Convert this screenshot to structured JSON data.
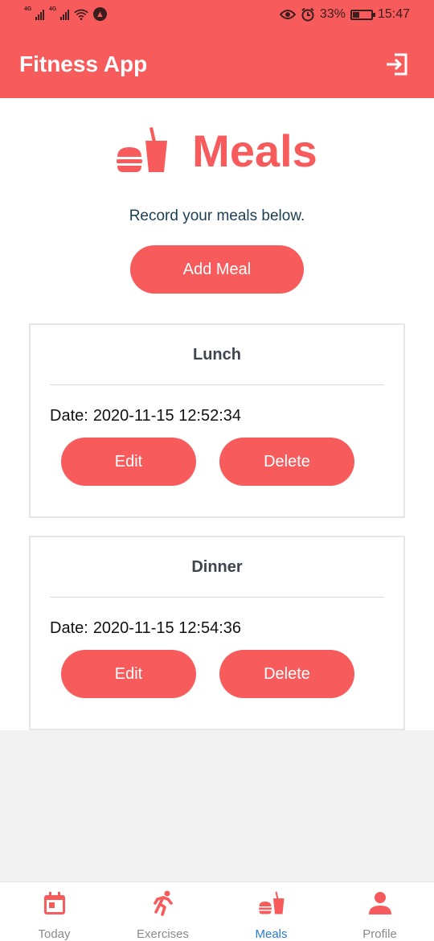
{
  "status_bar": {
    "signal1_label": "4G",
    "signal2_label": "4G",
    "battery_percent": "33%",
    "battery_level": 0.33,
    "time": "15:47",
    "icons": [
      "signal-icon",
      "signal-icon",
      "wifi-icon",
      "notification-icon",
      "eye-icon",
      "alarm-icon",
      "battery-icon"
    ]
  },
  "app_bar": {
    "title": "Fitness App",
    "action_icon": "logout-icon"
  },
  "page": {
    "heading": "Meals",
    "heading_icon": "fastfood-icon",
    "subtitle": "Record your meals below.",
    "add_button_label": "Add Meal"
  },
  "meals": [
    {
      "name": "Lunch",
      "date_label": "Date:",
      "date": "2020-11-15 12:52:34",
      "edit_label": "Edit",
      "delete_label": "Delete"
    },
    {
      "name": "Dinner",
      "date_label": "Date:",
      "date": "2020-11-15 12:54:36",
      "edit_label": "Edit",
      "delete_label": "Delete"
    }
  ],
  "bottom_nav": {
    "items": [
      {
        "label": "Today",
        "icon": "calendar-today-icon",
        "active": false
      },
      {
        "label": "Exercises",
        "icon": "running-icon",
        "active": false
      },
      {
        "label": "Meals",
        "icon": "fastfood-icon",
        "active": true
      },
      {
        "label": "Profile",
        "icon": "person-icon",
        "active": false
      }
    ]
  },
  "colors": {
    "primary": "#f75b5c",
    "active_nav": "#2a7bd1",
    "subtitle": "#1c3e52"
  }
}
